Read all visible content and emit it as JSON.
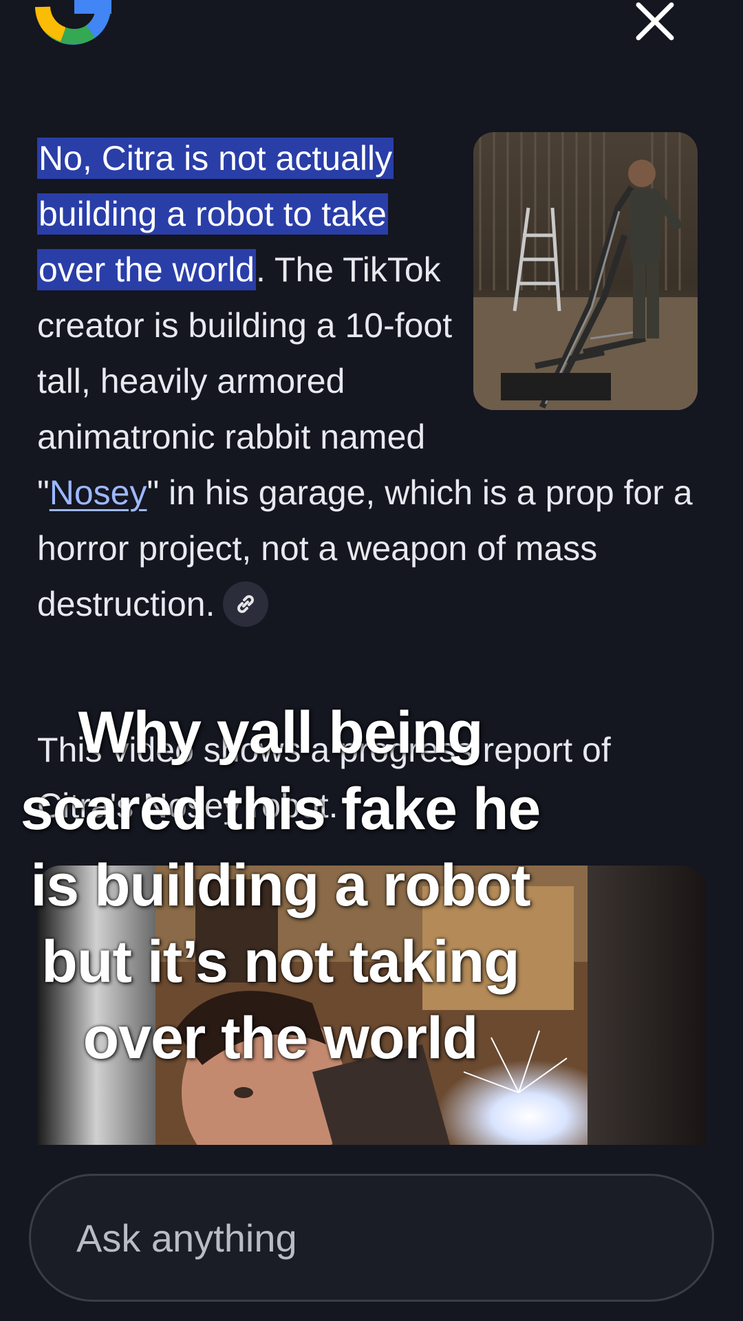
{
  "header": {
    "logo_icon": "google-g-logo",
    "close_icon": "close-x-icon"
  },
  "answer": {
    "highlight_text": "No, Citra is not actually building a robot to take over the world",
    "text_after_highlight": ". The TikTok creator is building a 10-foot tall, heavily armored animatronic rabbit named \"",
    "link_text": "Nosey",
    "text_after_link": "\" in his garage, which is a prop for a horror project, not a weapon of mass destruction.",
    "source_chip_icon": "link-icon",
    "image_icon": "man-with-robot-photo"
  },
  "answer2": {
    "text": "This video shows a progress report of Citra's Nosey robot."
  },
  "video": {
    "thumbnail_icon": "video-thumbnail-welding"
  },
  "overlay_caption": {
    "text": "Why yall being scared this fake he is building a robot but it’s not taking over the world"
  },
  "ask_bar": {
    "placeholder": "Ask anything"
  },
  "colors": {
    "background": "#141620",
    "highlight": "#2a3ea8",
    "link": "#9db8ff"
  }
}
